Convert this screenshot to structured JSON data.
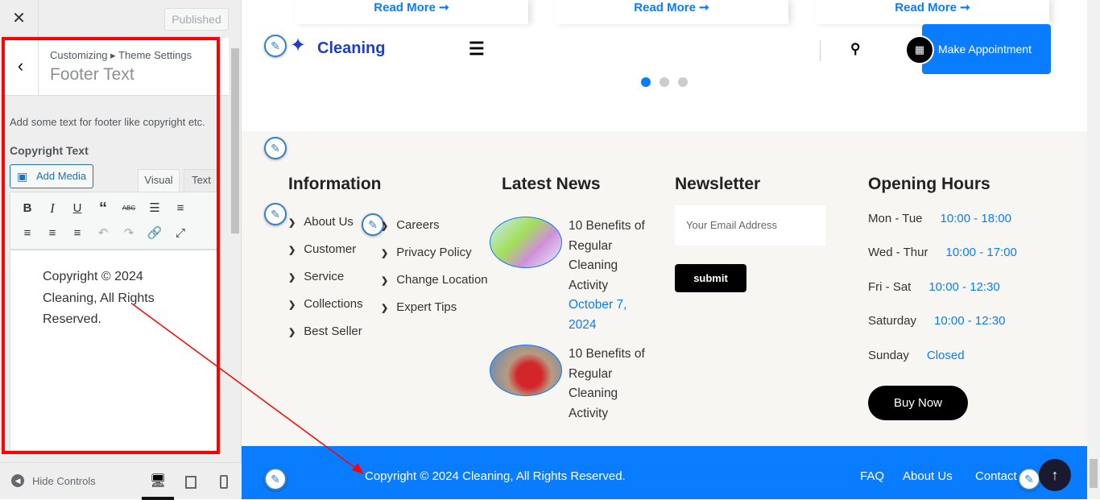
{
  "panel": {
    "close_icon": "close-icon",
    "published": "Published",
    "breadcrumb": "Customizing ▸ Theme Settings",
    "title": "Footer Text",
    "description": "Add some text for footer like copyright etc.",
    "field_label": "Copyright Text",
    "add_media": "Add Media",
    "tab_visual": "Visual",
    "tab_text": "Text",
    "editor_content": "Copyright © 2024 Cleaning, All Rights Reserved.",
    "hide_controls": "Hide Controls"
  },
  "header": {
    "read_more": "Read More ➞",
    "logo": "Cleaning",
    "appointment": "Make Appointment",
    "slider_dots": 3,
    "active_dot": 1
  },
  "footer": {
    "information": {
      "title": "Information",
      "col1": [
        "About Us",
        "Customer",
        "Service",
        "Collections",
        "Best Seller"
      ],
      "col2": [
        "Careers",
        "Privacy Policy",
        "Change Location",
        "Expert Tips"
      ]
    },
    "news": {
      "title": "Latest News",
      "items": [
        {
          "title": "10 Benefits of Regular Cleaning Activity",
          "date": "October 7, 2024"
        },
        {
          "title": "10 Benefits of Regular Cleaning Activity"
        }
      ]
    },
    "newsletter": {
      "title": "Newsletter",
      "placeholder": "Your Email Address",
      "submit": "submit"
    },
    "hours": {
      "title": "Opening Hours",
      "rows": [
        {
          "day": "Mon - Tue",
          "time": "10:00 - 18:00"
        },
        {
          "day": "Wed - Thur",
          "time": "10:00 - 17:00"
        },
        {
          "day": "Fri - Sat",
          "time": "10:00 - 12:30"
        },
        {
          "day": "Saturday",
          "time": "10:00 - 12:30"
        },
        {
          "day": "Sunday",
          "time": "Closed"
        }
      ],
      "buy_now": "Buy Now"
    }
  },
  "bottom_bar": {
    "copyright": "Copyright © 2024 Cleaning, All Rights Reserved.",
    "links": [
      "FAQ",
      "About Us",
      "Contact"
    ]
  },
  "colors": {
    "accent": "#0a7cff",
    "annotation": "#ff0000"
  }
}
